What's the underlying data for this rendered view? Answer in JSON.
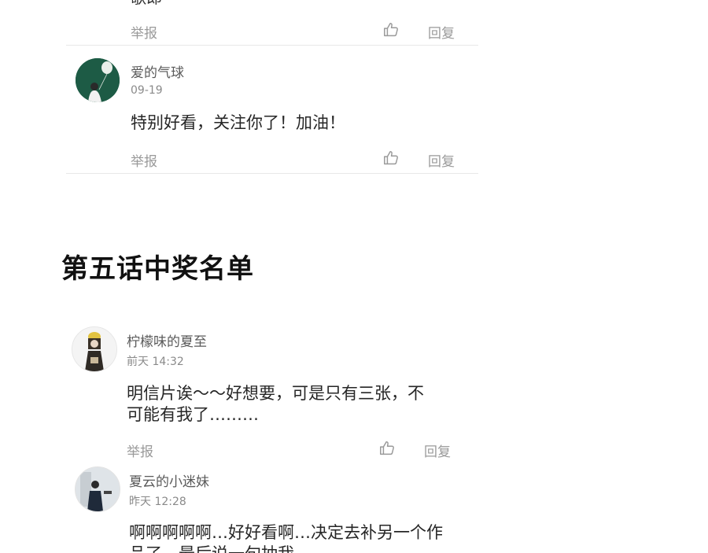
{
  "top_comment": {
    "clipped_text": "歌郎",
    "report_label": "举报",
    "reply_label": "回复"
  },
  "comment_1": {
    "username": "爱的气球",
    "time": "09-19",
    "content": "特别好看，关注你了！加油！",
    "report_label": "举报",
    "reply_label": "回复"
  },
  "section": {
    "title": "第五话中奖名单"
  },
  "comment_2": {
    "username": "柠檬味的夏至",
    "time": "前天 14:32",
    "content_line1": "明信片诶～～好想要，可是只有三张，不",
    "content_line2": "可能有我了………",
    "report_label": "举报",
    "reply_label": "回复"
  },
  "comment_3": {
    "username": "夏云的小迷妹",
    "time": "昨天 12:28",
    "content_line1": "啊啊啊啊啊…好好看啊…决定去补另一个作",
    "content_line2": "品了，最后说一句抽我"
  },
  "icons": {
    "like": "thumbs-up-outline",
    "accent_gray": "#9a9a9a"
  }
}
